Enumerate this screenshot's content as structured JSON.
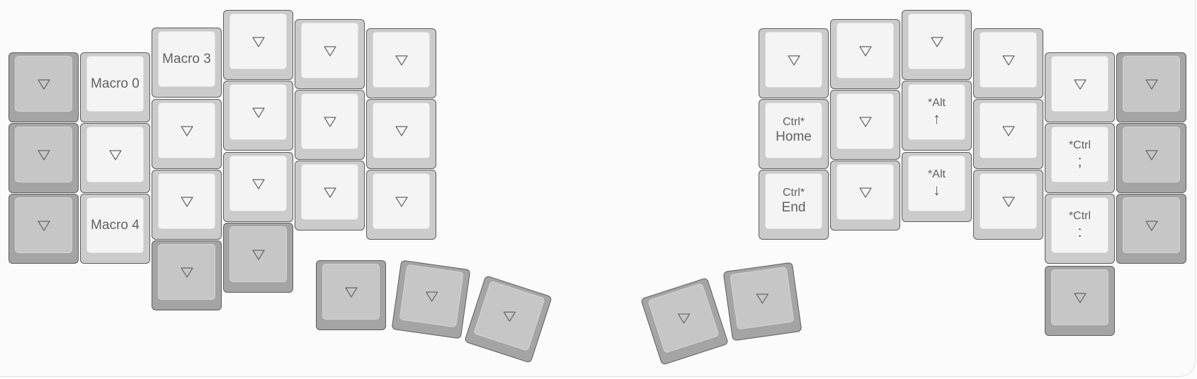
{
  "layout_name": "split-ergonomic-keyboard",
  "colors": {
    "light_key_base": "#cbcbcb",
    "light_key_cap": "#f4f4f4",
    "dark_key_base": "#a4a4a4",
    "dark_key_cap": "#c6c6c6",
    "legend": "#616161",
    "outline": "#5d5d5d"
  },
  "transparent_legend_icon": "triangle-down-icon",
  "left_half": {
    "keys": [
      {
        "id": "l-c0-r0",
        "tone": "dark"
      },
      {
        "id": "l-c0-r1",
        "tone": "dark"
      },
      {
        "id": "l-c0-r2",
        "tone": "dark"
      },
      {
        "id": "l-c1-r0",
        "tone": "light",
        "label": "Macro 0"
      },
      {
        "id": "l-c1-r1",
        "tone": "light"
      },
      {
        "id": "l-c1-r2",
        "tone": "light",
        "label": "Macro 4"
      },
      {
        "id": "l-c2-r0",
        "tone": "light",
        "label": "Macro 3"
      },
      {
        "id": "l-c2-r1",
        "tone": "light"
      },
      {
        "id": "l-c2-r2",
        "tone": "light"
      },
      {
        "id": "l-c2-r3",
        "tone": "dark"
      },
      {
        "id": "l-c3-r0",
        "tone": "light"
      },
      {
        "id": "l-c3-r1",
        "tone": "light"
      },
      {
        "id": "l-c3-r2",
        "tone": "light"
      },
      {
        "id": "l-c3-r3",
        "tone": "dark"
      },
      {
        "id": "l-c4-r0",
        "tone": "light"
      },
      {
        "id": "l-c4-r1",
        "tone": "light"
      },
      {
        "id": "l-c4-r2",
        "tone": "light"
      },
      {
        "id": "l-c5-r0",
        "tone": "light"
      },
      {
        "id": "l-c5-r1",
        "tone": "light"
      },
      {
        "id": "l-c5-r2",
        "tone": "light"
      },
      {
        "id": "l-thumb-0",
        "tone": "dark"
      },
      {
        "id": "l-thumb-1",
        "tone": "dark"
      },
      {
        "id": "l-thumb-2",
        "tone": "dark"
      }
    ]
  },
  "right_half": {
    "keys": [
      {
        "id": "r-c0-r0",
        "tone": "light"
      },
      {
        "id": "r-c0-r1",
        "tone": "light",
        "top": "Ctrl*",
        "label": "Home"
      },
      {
        "id": "r-c0-r2",
        "tone": "light",
        "top": "Ctrl*",
        "label": "End"
      },
      {
        "id": "r-c1-r0",
        "tone": "light"
      },
      {
        "id": "r-c1-r1",
        "tone": "light"
      },
      {
        "id": "r-c1-r2",
        "tone": "light"
      },
      {
        "id": "r-c2-r0",
        "tone": "light"
      },
      {
        "id": "r-c2-r1",
        "tone": "light",
        "top": "*Alt",
        "symbol": "↑"
      },
      {
        "id": "r-c2-r2",
        "tone": "light",
        "top": "*Alt",
        "symbol": "↓"
      },
      {
        "id": "r-c3-r0",
        "tone": "light"
      },
      {
        "id": "r-c3-r1",
        "tone": "light"
      },
      {
        "id": "r-c3-r2",
        "tone": "light"
      },
      {
        "id": "r-c4-r0",
        "tone": "light"
      },
      {
        "id": "r-c4-r1",
        "tone": "light",
        "top": "*Ctrl",
        "symbol": ";"
      },
      {
        "id": "r-c4-r2",
        "tone": "light",
        "top": "*Ctrl",
        "symbol": ":"
      },
      {
        "id": "r-c4-r3",
        "tone": "dark"
      },
      {
        "id": "r-c5-r0",
        "tone": "dark"
      },
      {
        "id": "r-c5-r1",
        "tone": "dark"
      },
      {
        "id": "r-c5-r2",
        "tone": "dark"
      },
      {
        "id": "r-thumb-0",
        "tone": "dark"
      },
      {
        "id": "r-thumb-1",
        "tone": "dark"
      }
    ]
  }
}
